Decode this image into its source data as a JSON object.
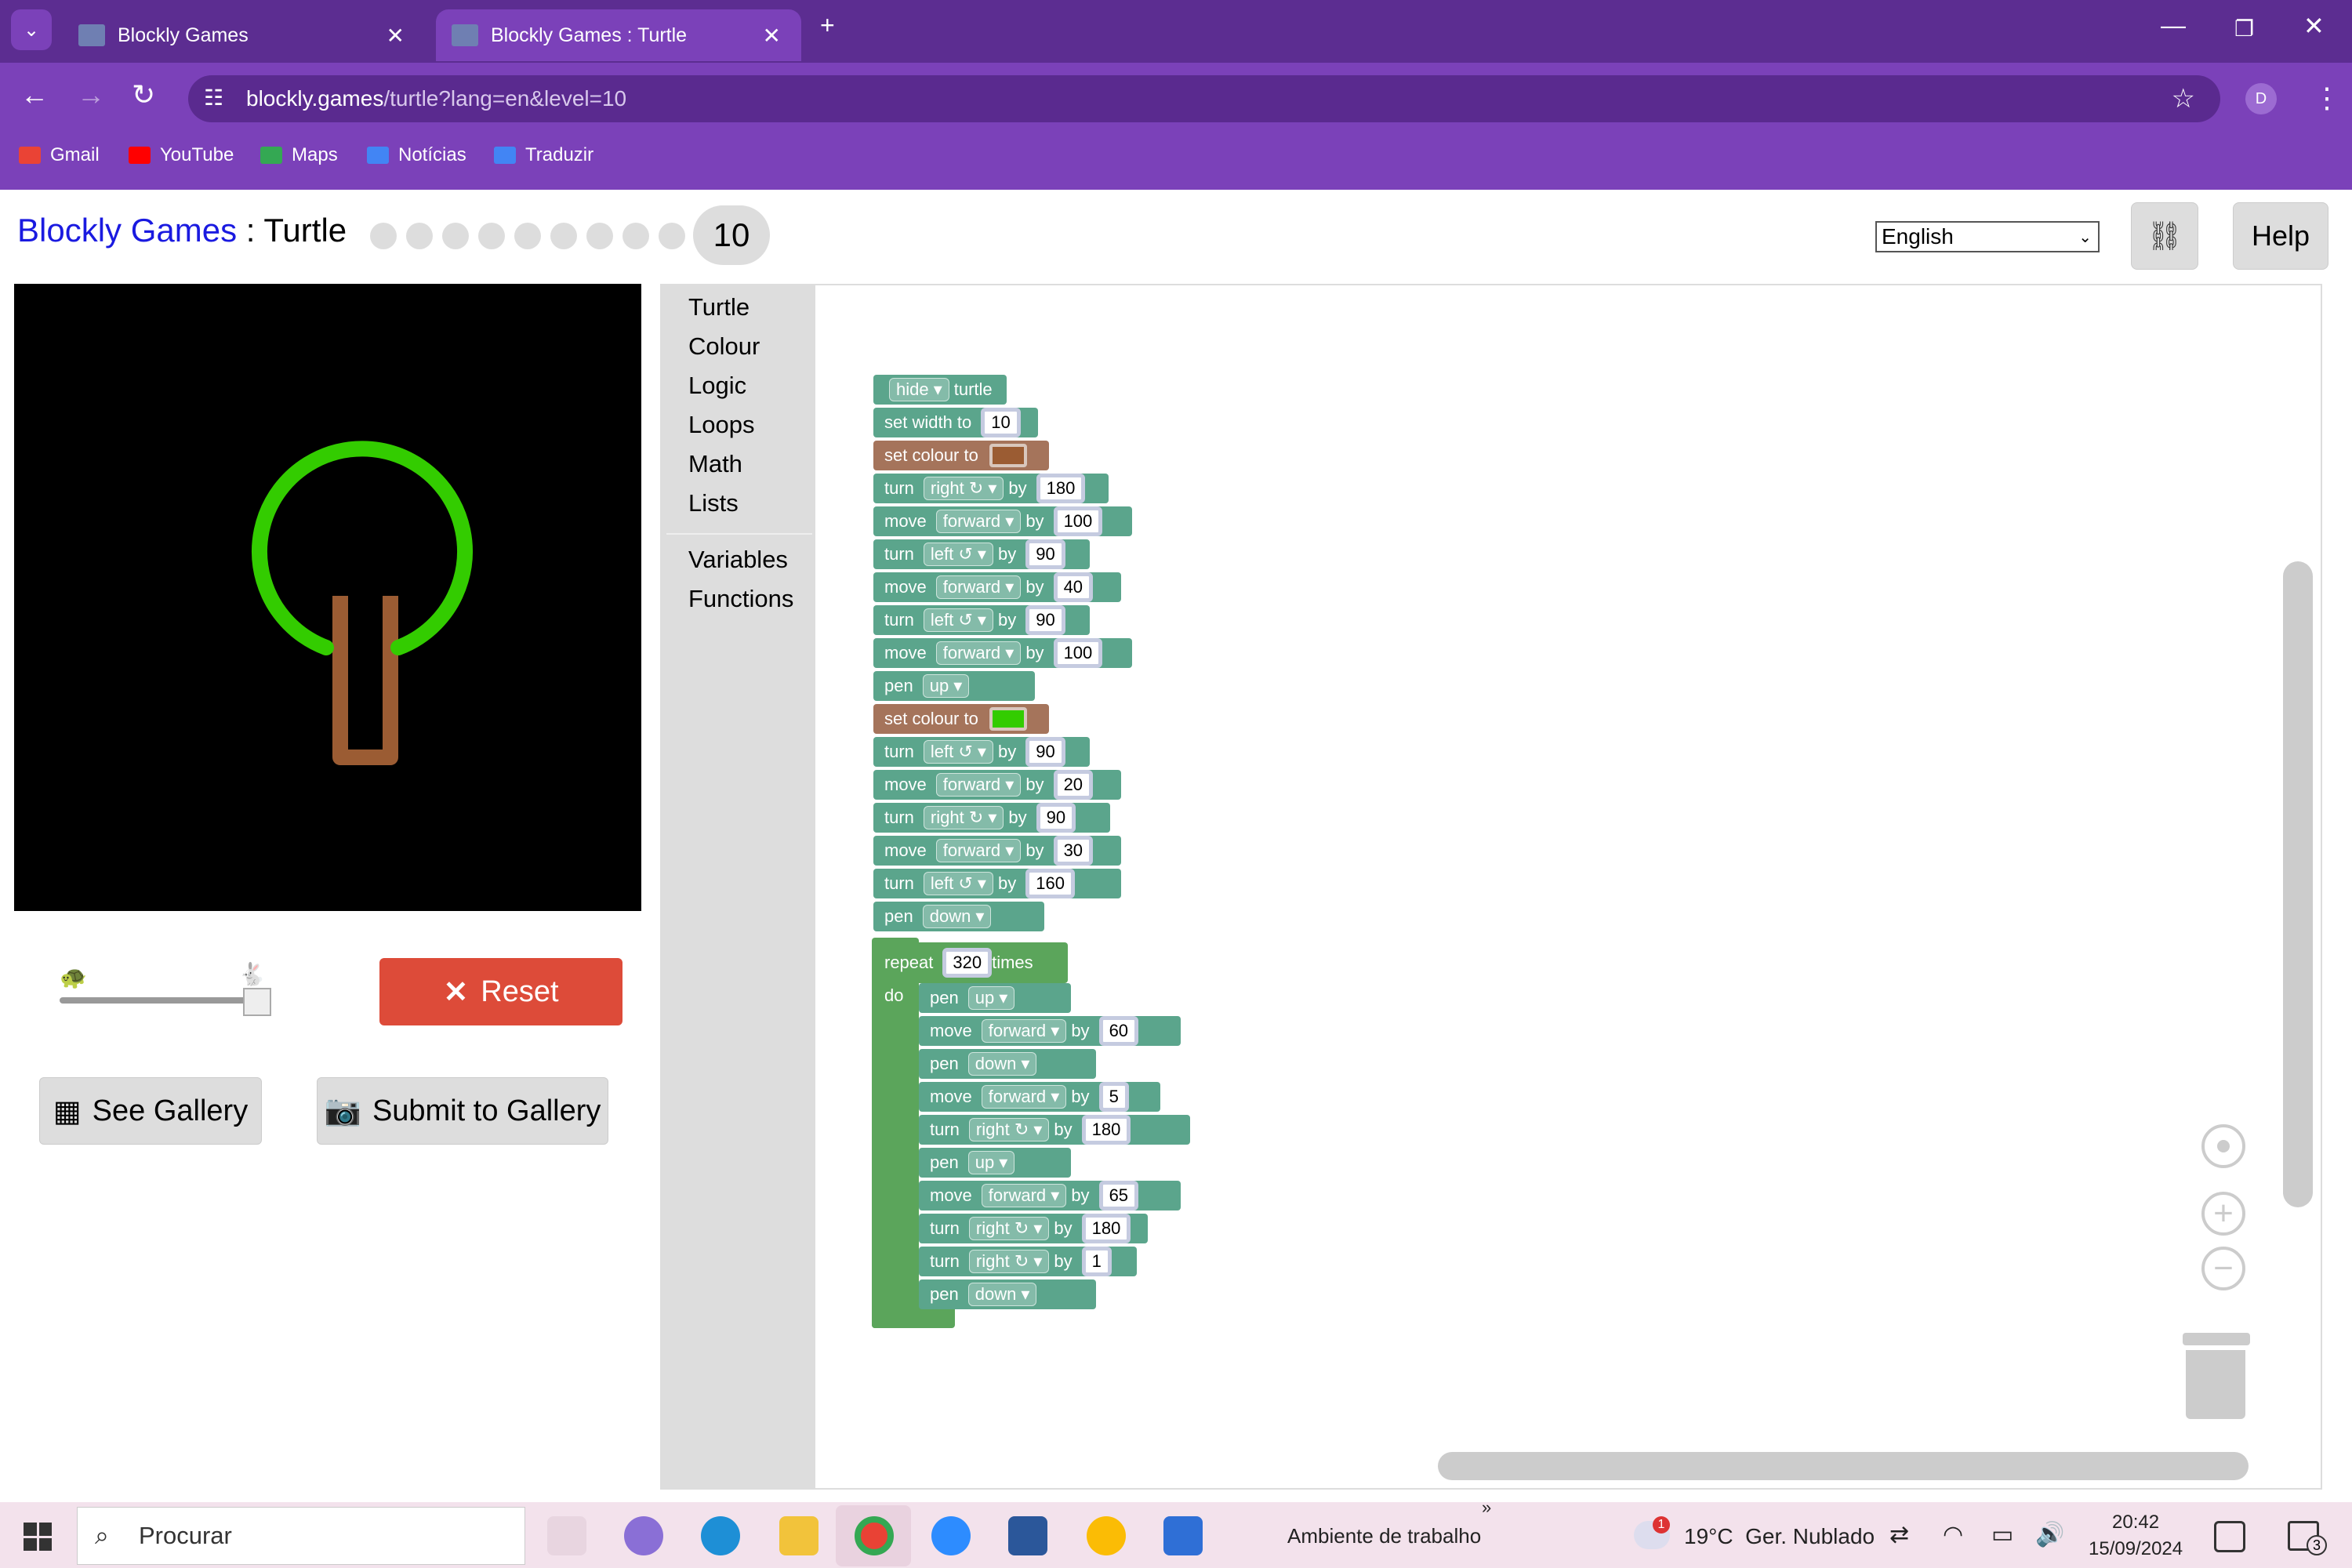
{
  "browser": {
    "tabs": [
      {
        "title": "Blockly Games"
      },
      {
        "title": "Blockly Games : Turtle"
      }
    ],
    "url_host": "blockly.games",
    "url_path": "/turtle?lang=en&level=10",
    "profile_initial": "D",
    "bookmarks": [
      "Gmail",
      "YouTube",
      "Maps",
      "Notícias",
      "Traduzir"
    ]
  },
  "page": {
    "brand": "Blockly Games",
    "separator": " : ",
    "app": "Turtle",
    "level": "10",
    "language": "English",
    "help_label": "Help",
    "reset_label": "Reset",
    "gallery_label": "See Gallery",
    "submit_label": "Submit to Gallery",
    "speed_fraction": 1.0
  },
  "toolbox": [
    "Turtle",
    "Colour",
    "Logic",
    "Loops",
    "Math",
    "Lists",
    "Variables",
    "Functions"
  ],
  "blocks": [
    {
      "words": [
        "hide",
        "turtle"
      ]
    },
    {
      "words": [
        "set width to",
        "10"
      ]
    },
    {
      "words": [
        "set colour to"
      ],
      "colour": "#9b5c33"
    },
    {
      "words": [
        "turn",
        "right ↻",
        "by",
        "180"
      ]
    },
    {
      "words": [
        "move",
        "forward",
        "by",
        "100"
      ]
    },
    {
      "words": [
        "turn",
        "left ↺",
        "by",
        "90"
      ]
    },
    {
      "words": [
        "move",
        "forward",
        "by",
        "40"
      ]
    },
    {
      "words": [
        "turn",
        "left ↺",
        "by",
        "90"
      ]
    },
    {
      "words": [
        "move",
        "forward",
        "by",
        "100"
      ]
    },
    {
      "words": [
        "pen",
        "up"
      ]
    },
    {
      "words": [
        "set colour to"
      ],
      "colour": "#33cc00"
    },
    {
      "words": [
        "turn",
        "left ↺",
        "by",
        "90"
      ]
    },
    {
      "words": [
        "move",
        "forward",
        "by",
        "20"
      ]
    },
    {
      "words": [
        "turn",
        "right ↻",
        "by",
        "90"
      ]
    },
    {
      "words": [
        "move",
        "forward",
        "by",
        "30"
      ]
    },
    {
      "words": [
        "turn",
        "left ↺",
        "by",
        "160"
      ]
    },
    {
      "words": [
        "pen",
        "down"
      ]
    },
    {
      "words": [
        "repeat",
        "320",
        "times"
      ]
    },
    {
      "words": [
        "do"
      ]
    },
    {
      "words": [
        "pen",
        "up"
      ]
    },
    {
      "words": [
        "move",
        "forward",
        "by",
        "60"
      ]
    },
    {
      "words": [
        "pen",
        "down"
      ]
    },
    {
      "words": [
        "move",
        "forward",
        "by",
        "5"
      ]
    },
    {
      "words": [
        "turn",
        "right ↻",
        "by",
        "180"
      ]
    },
    {
      "words": [
        "pen",
        "up"
      ]
    },
    {
      "words": [
        "move",
        "forward",
        "by",
        "65"
      ]
    },
    {
      "words": [
        "turn",
        "right ↻",
        "by",
        "180"
      ]
    },
    {
      "words": [
        "turn",
        "right ↻",
        "by",
        "1"
      ]
    },
    {
      "words": [
        "pen",
        "down"
      ]
    }
  ],
  "taskbar": {
    "search_placeholder": "Procurar",
    "desktop_label": "Ambiente de trabalho",
    "weather": "19°C  Ger. Nublado",
    "weather_badge": "1",
    "time": "20:42",
    "date": "15/09/2024",
    "notif_count": "3"
  },
  "colors": {
    "tabstrip": "#5c2d91",
    "toolbar": "#7b41b9",
    "reset": "#dd4b39",
    "turtle_block": "#5ba58c",
    "colour_block": "#a5745b",
    "loop_block": "#5ba55b"
  }
}
